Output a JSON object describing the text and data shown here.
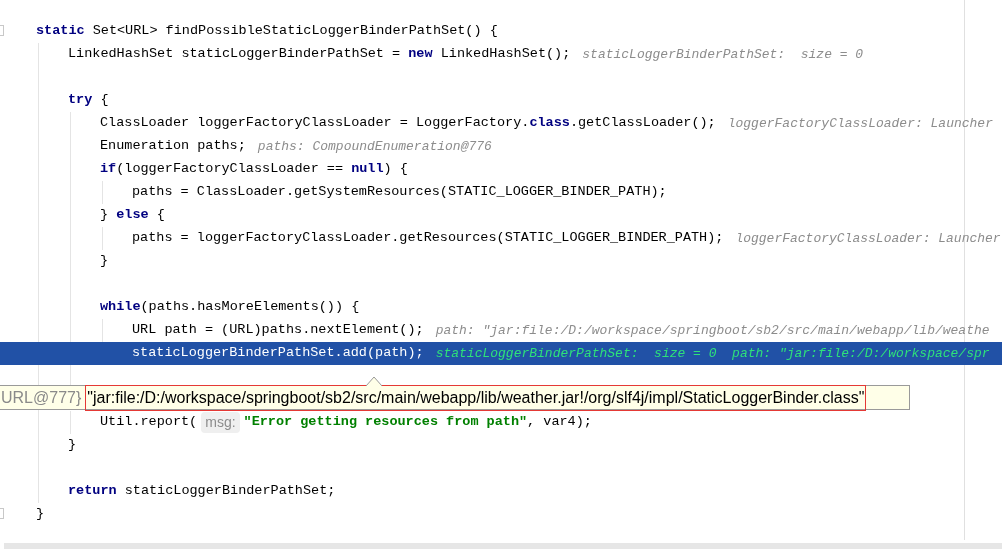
{
  "lines": [
    {
      "selected": false,
      "tokens": [
        {
          "kind": "keyword",
          "text": "static"
        },
        {
          "kind": "code",
          "text": " Set<URL> findPossibleStaticLoggerBinderPathSet() {"
        }
      ],
      "children": [
        {
          "selected": false,
          "tokens": [
            {
              "kind": "code",
              "text": "LinkedHashSet staticLoggerBinderPathSet = "
            },
            {
              "kind": "keyword",
              "text": "new"
            },
            {
              "kind": "code",
              "text": " LinkedHashSet();"
            },
            {
              "kind": "hint",
              "text": "staticLoggerBinderPathSet:  size = 0"
            }
          ]
        },
        {
          "selected": false
        },
        {
          "selected": false,
          "tokens": [
            {
              "kind": "keyword",
              "text": "try"
            },
            {
              "kind": "code",
              "text": " {"
            }
          ],
          "children": [
            {
              "selected": false,
              "tokens": [
                {
                  "kind": "code",
                  "text": "ClassLoader loggerFactoryClassLoader = LoggerFactory."
                },
                {
                  "kind": "keyword",
                  "text": "class"
                },
                {
                  "kind": "code",
                  "text": ".getClassLoader();"
                },
                {
                  "kind": "hint",
                  "text": "loggerFactoryClassLoader: Launcher"
                }
              ]
            },
            {
              "selected": false,
              "tokens": [
                {
                  "kind": "code",
                  "text": "Enumeration paths;"
                },
                {
                  "kind": "hint",
                  "text": "paths: CompoundEnumeration@776"
                }
              ]
            },
            {
              "selected": false,
              "tokens": [
                {
                  "kind": "keyword",
                  "text": "if"
                },
                {
                  "kind": "code",
                  "text": "(loggerFactoryClassLoader == "
                },
                {
                  "kind": "keyword",
                  "text": "null"
                },
                {
                  "kind": "code",
                  "text": ") {"
                }
              ],
              "children": [
                {
                  "selected": false,
                  "tokens": [
                    {
                      "kind": "code",
                      "text": "paths = ClassLoader.getSystemResources(STATIC_LOGGER_BINDER_PATH);"
                    }
                  ]
                }
              ]
            },
            {
              "selected": false,
              "tokens": [
                {
                  "kind": "code",
                  "text": "} "
                },
                {
                  "kind": "keyword",
                  "text": "else"
                },
                {
                  "kind": "code",
                  "text": " {"
                }
              ],
              "children": [
                {
                  "selected": false,
                  "tokens": [
                    {
                      "kind": "code",
                      "text": "paths = loggerFactoryClassLoader.getResources(STATIC_LOGGER_BINDER_PATH);"
                    },
                    {
                      "kind": "hint",
                      "text": "loggerFactoryClassLoader: Launcher"
                    }
                  ]
                }
              ]
            },
            {
              "selected": false,
              "tokens": [
                {
                  "kind": "code",
                  "text": "}"
                }
              ]
            },
            {
              "selected": false
            },
            {
              "selected": false,
              "tokens": [
                {
                  "kind": "keyword",
                  "text": "while"
                },
                {
                  "kind": "code",
                  "text": "(paths.hasMoreElements()) {"
                }
              ],
              "children": [
                {
                  "selected": false,
                  "tokens": [
                    {
                      "kind": "code",
                      "text": "URL path = (URL)paths.nextElement();"
                    },
                    {
                      "kind": "hint",
                      "text": "path: \"jar:file:/D:/workspace/springboot/sb2/src/main/webapp/lib/weathe"
                    }
                  ]
                },
                {
                  "selected": true,
                  "tokens": [
                    {
                      "kind": "code",
                      "text": "staticLoggerBinderPathSet.add(path);"
                    },
                    {
                      "kind": "hint",
                      "text": "staticLoggerBinderPathSet:  size = 0  path: \"jar:file:/D:/workspace/spr"
                    }
                  ]
                }
              ]
            },
            {
              "selected": false
            }
          ]
        },
        {
          "selected": false,
          "children": [
            {
              "selected": false,
              "tokens": [
                {
                  "kind": "code",
                  "text": "Util.report("
                },
                {
                  "kind": "param",
                  "text": "msg:"
                },
                {
                  "kind": "string",
                  "text": "\"Error getting resources from path\""
                },
                {
                  "kind": "code",
                  "text": ", var4);"
                }
              ]
            }
          ]
        },
        {
          "selected": false,
          "tokens": [
            {
              "kind": "code",
              "text": "}"
            }
          ]
        },
        {
          "selected": false
        },
        {
          "selected": false,
          "tokens": [
            {
              "kind": "keyword",
              "text": "return"
            },
            {
              "kind": "code",
              "text": " staticLoggerBinderPathSet;"
            }
          ]
        }
      ]
    },
    {
      "selected": false,
      "tokens": [
        {
          "kind": "code",
          "text": "}"
        }
      ]
    }
  ],
  "tooltip": {
    "prefix": "URL@777}",
    "value": "\"jar:file:/D:/workspace/springboot/sb2/src/main/webapp/lib/weather.jar!/org/slf4j/impl/StaticLoggerBinder.class\""
  }
}
